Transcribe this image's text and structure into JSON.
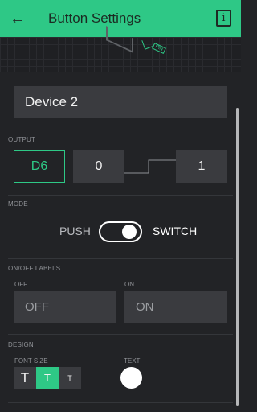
{
  "appbar": {
    "title": "Button Settings",
    "back_icon": "arrow-left-icon",
    "info_icon": "info-icon",
    "info_glyph": "i"
  },
  "preview": {
    "pin_tag": "PIN"
  },
  "device": {
    "name": "Device 2"
  },
  "output": {
    "section": "OUTPUT",
    "pin": "D6",
    "low": "0",
    "high": "1"
  },
  "mode": {
    "section": "MODE",
    "left": "PUSH",
    "right": "SWITCH",
    "state": "SWITCH"
  },
  "labels": {
    "section": "ON/OFF LABELS",
    "off_label": "OFF",
    "on_label": "ON",
    "off_value": "OFF",
    "on_value": "ON"
  },
  "design": {
    "section": "DESIGN",
    "font_size_label": "FONT SIZE",
    "text_label": "TEXT",
    "font_sizes": [
      "T",
      "T",
      "T"
    ],
    "selected_font_index": 1,
    "text_color": "#ffffff"
  },
  "colors": {
    "accent": "#2ec886",
    "background": "#222326",
    "field": "#3a3b3f"
  }
}
